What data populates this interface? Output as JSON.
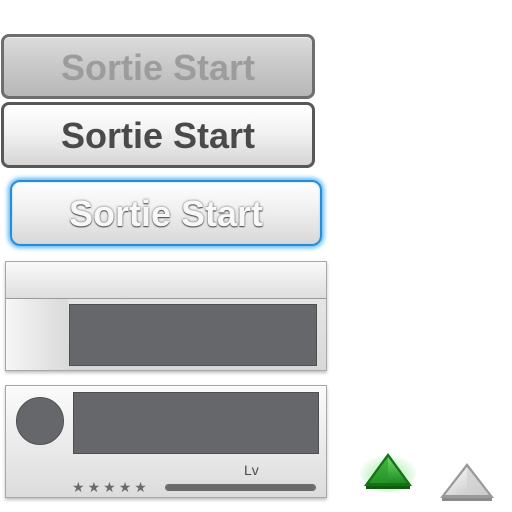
{
  "buttons": {
    "disabled_label": "Sortie Start",
    "normal_label": "Sortie Start",
    "focused_label": "Sortie Start"
  },
  "profile_panel": {
    "level_label": "Lv",
    "stars": [
      "★",
      "★",
      "★",
      "★",
      "★"
    ],
    "level_progress": 1.0
  },
  "arrows": {
    "green_icon": "triangle-up-green-icon",
    "white_icon": "triangle-up-white-icon"
  },
  "colors": {
    "focus_glow": "#5ab8f5",
    "slot_gray": "#66676b",
    "arrow_green": "#2fa32f"
  }
}
